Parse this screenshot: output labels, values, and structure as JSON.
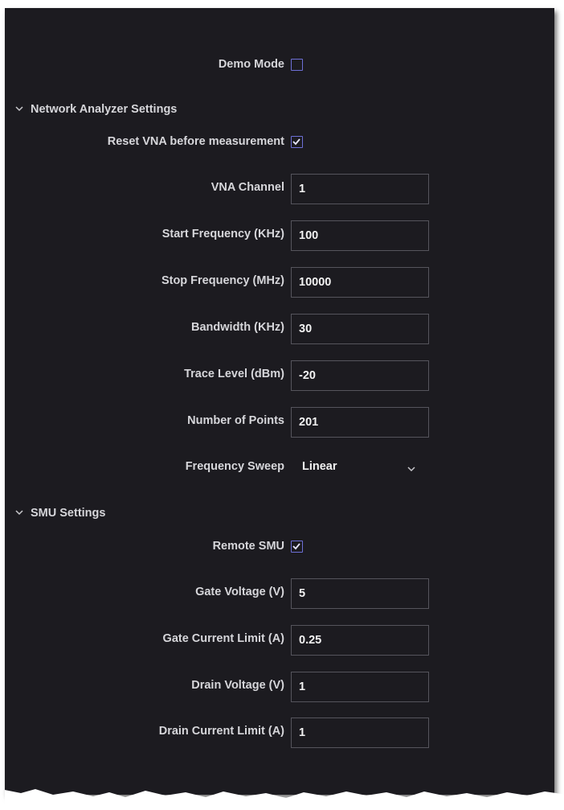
{
  "demo_mode": {
    "label": "Demo Mode",
    "checked": false
  },
  "network_analyzer": {
    "title": "Network Analyzer Settings",
    "reset_vna": {
      "label": "Reset VNA before measurement",
      "checked": true
    },
    "fields": [
      {
        "label": "VNA Channel",
        "value": "1"
      },
      {
        "label": "Start Frequency (KHz)",
        "value": "100"
      },
      {
        "label": "Stop Frequency (MHz)",
        "value": "10000"
      },
      {
        "label": "Bandwidth (KHz)",
        "value": "30"
      },
      {
        "label": "Trace Level (dBm)",
        "value": "-20"
      },
      {
        "label": "Number of Points",
        "value": "201"
      }
    ],
    "frequency_sweep": {
      "label": "Frequency Sweep",
      "value": "Linear"
    }
  },
  "smu": {
    "title": "SMU Settings",
    "remote_smu": {
      "label": "Remote SMU",
      "checked": true
    },
    "fields": [
      {
        "label": "Gate Voltage (V)",
        "value": "5"
      },
      {
        "label": "Gate Current Limit (A)",
        "value": "0.25"
      },
      {
        "label": "Drain Voltage (V)",
        "value": "1"
      },
      {
        "label": "Drain Current Limit (A)",
        "value": "1"
      }
    ]
  },
  "colors": {
    "background": "#1c1b20",
    "checkbox_accent": "#6d6fd6",
    "text": "#d6d6da"
  }
}
